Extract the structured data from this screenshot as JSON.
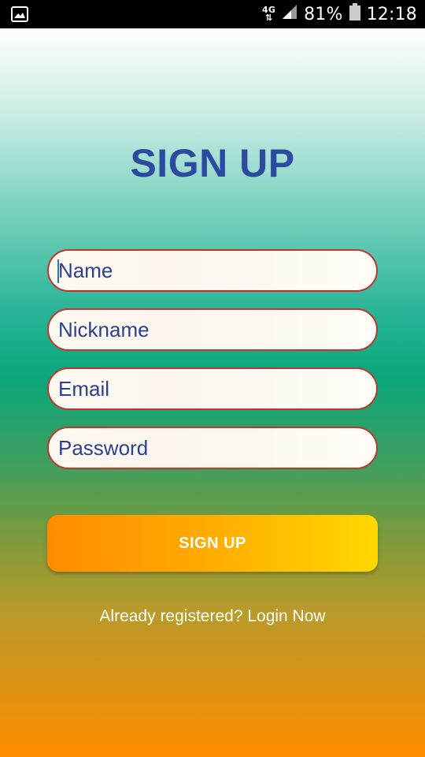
{
  "status_bar": {
    "network": "4G",
    "battery": "81%",
    "time": "12:18",
    "icons": [
      "gallery-icon",
      "network-4g-icon",
      "signal-icon",
      "battery-icon"
    ]
  },
  "title": "SIGN UP",
  "form": {
    "name_placeholder": "Name",
    "nickname_placeholder": "Nickname",
    "email_placeholder": "Email",
    "password_placeholder": "Password"
  },
  "signup_button": {
    "label": "SIGN UP"
  },
  "login_link": "Already registered? Login Now",
  "colors": {
    "title": "#2b4aa0",
    "field_border": "#c2352f",
    "field_text": "#2b3f94",
    "button_start": "#ff8c00",
    "button_end": "#ffd800",
    "gradient_top": "#ffffff",
    "gradient_mid": "#0aa67c",
    "gradient_bottom": "#ff8c00"
  }
}
